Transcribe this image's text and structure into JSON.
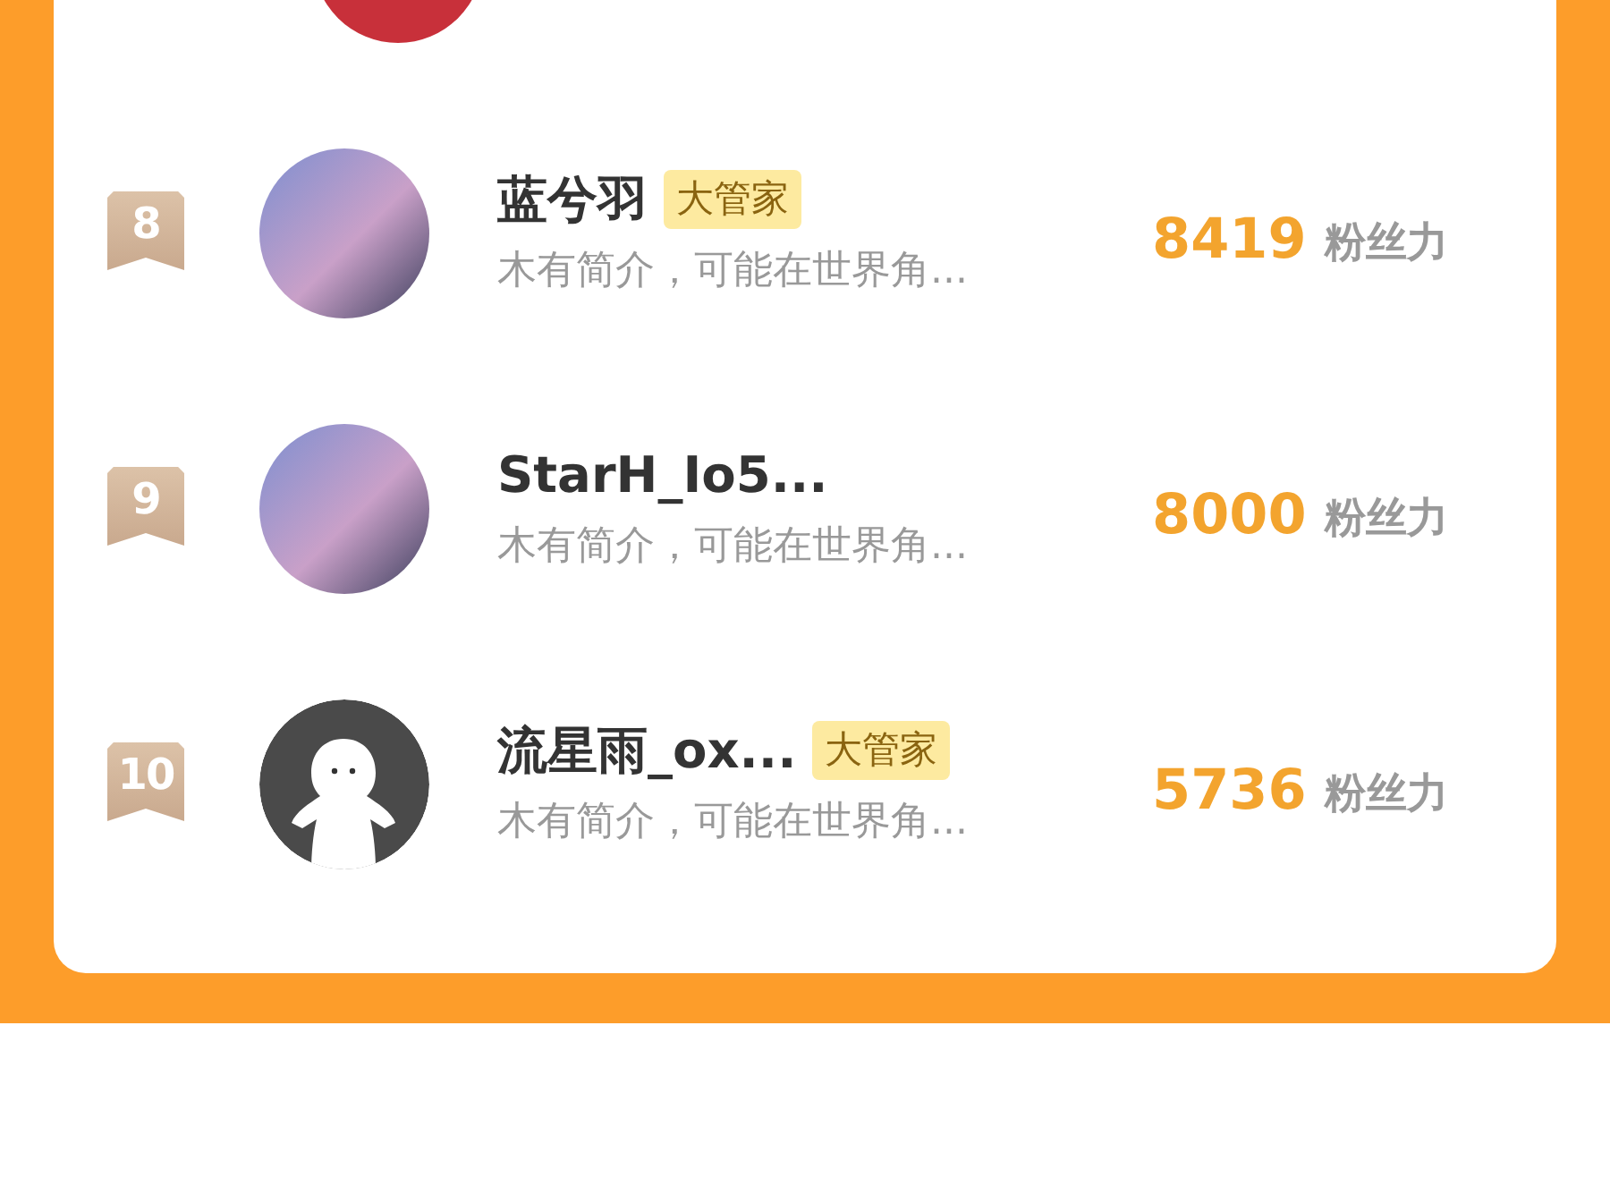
{
  "ranking": [
    {
      "rank": "8",
      "name": "蓝兮羽",
      "tag": "大管家",
      "bio": "木有简介，可能在世界角...",
      "score": "8419",
      "score_unit": "粉丝力",
      "kind": "photo"
    },
    {
      "rank": "9",
      "name": "StarH_Io5...",
      "bio": "木有简介，可能在世界角...",
      "score": "8000",
      "score_unit": "粉丝力",
      "kind": "photo"
    },
    {
      "rank": "10",
      "name": "流星雨_ox...",
      "tag": "大管家",
      "bio": "木有简介，可能在世界角...",
      "score": "5736",
      "score_unit": "粉丝力",
      "kind": "default"
    }
  ]
}
